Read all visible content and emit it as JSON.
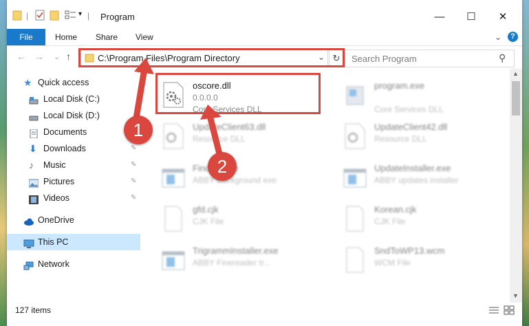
{
  "window": {
    "title": "Program"
  },
  "titlebar": {
    "minimize_glyph": "—",
    "maximize_glyph": "☐",
    "close_glyph": "✕",
    "qa_dropdown_glyph": "▾",
    "separator": "|"
  },
  "ribbon": {
    "file_label": "File",
    "tabs": [
      "Home",
      "Share",
      "View"
    ],
    "expand_glyph": "⌄",
    "help_glyph": "?"
  },
  "nav": {
    "back_glyph": "←",
    "forward_glyph": "→",
    "recent_glyph": "⌄",
    "up_glyph": "↑"
  },
  "address": {
    "path": "C:\\Program Files\\Program Directory",
    "dropdown_glyph": "⌄",
    "refresh_glyph": "↻"
  },
  "search": {
    "placeholder": "Search Program",
    "icon_glyph": "⚲"
  },
  "sidebar": {
    "items": [
      {
        "label": "Quick access",
        "icon": "star-icon"
      },
      {
        "label": "Local Disk (C:)",
        "icon": "drive-icon"
      },
      {
        "label": "Local Disk (D:)",
        "icon": "drive-icon"
      },
      {
        "label": "Documents",
        "icon": "documents-icon"
      },
      {
        "label": "Downloads",
        "icon": "download-icon"
      },
      {
        "label": "Music",
        "icon": "music-icon"
      },
      {
        "label": "Pictures",
        "icon": "pictures-icon"
      },
      {
        "label": "Videos",
        "icon": "videos-icon"
      },
      {
        "label": "OneDrive",
        "icon": "cloud-icon"
      },
      {
        "label": "This PC",
        "icon": "computer-icon"
      },
      {
        "label": "Network",
        "icon": "network-icon"
      }
    ],
    "pin_glyph": "📌"
  },
  "files": [
    {
      "name": "oscore.dll",
      "line2": "0.0.0.0",
      "line3": "Core Services DLL",
      "icon": "dll-gear-icon",
      "highlighted": true
    },
    {
      "name": "program.exe",
      "line2": "",
      "line3": "Core Services DLL",
      "icon": "exe-icon",
      "highlighted": false
    },
    {
      "name": "UpdateClient63.dll",
      "line2": "Resource DLL",
      "line3": "",
      "icon": "dll-gear-icon",
      "highlighted": false
    },
    {
      "name": "UpdateClient42.dll",
      "line2": "Resource DLL",
      "line3": "",
      "icon": "dll-gear-icon",
      "highlighted": false
    },
    {
      "name": "Findfile.exe",
      "line2": "ABBY Background exe",
      "line3": "",
      "icon": "app-window-icon",
      "highlighted": false
    },
    {
      "name": "UpdateInstaller.exe",
      "line2": "ABBY updates installer",
      "line3": "",
      "icon": "app-window-icon",
      "highlighted": false
    },
    {
      "name": "gfd.cjk",
      "line2": "CJK File",
      "line3": "",
      "icon": "blank-file-icon",
      "highlighted": false
    },
    {
      "name": "Korean.cjk",
      "line2": "CJK File",
      "line3": "",
      "icon": "blank-file-icon",
      "highlighted": false
    },
    {
      "name": "TrigrammInstaller.exe",
      "line2": "ABBY Finereader tr...",
      "line3": "",
      "icon": "app-window-icon",
      "highlighted": false
    },
    {
      "name": "SndToWP13.wcm",
      "line2": "WCM File",
      "line3": "",
      "icon": "blank-file-icon",
      "highlighted": false
    }
  ],
  "status": {
    "item_count": "127 items"
  },
  "annotations": {
    "step1": "1",
    "step2": "2"
  },
  "colors": {
    "accent": "#1979ca",
    "highlight": "#d9473e",
    "selection": "#cce8ff"
  }
}
